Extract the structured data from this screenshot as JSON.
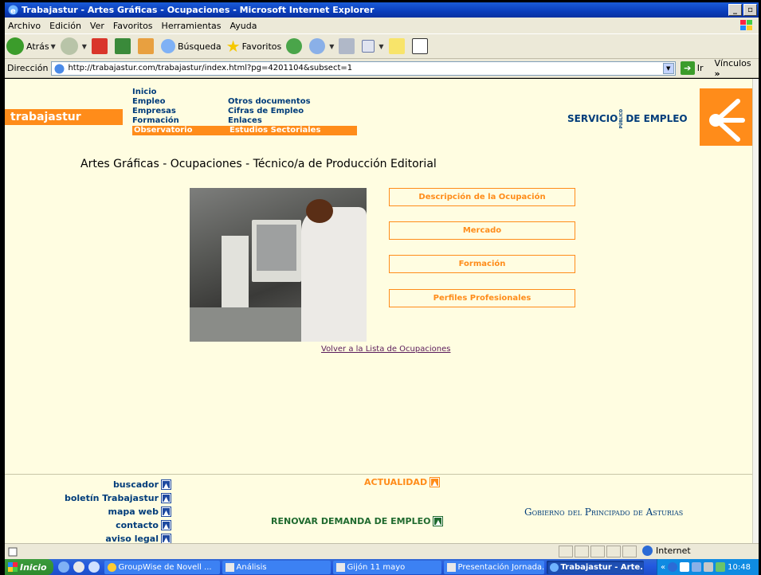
{
  "window": {
    "title": "Trabajastur - Artes Gráficas - Ocupaciones - Microsoft Internet Explorer"
  },
  "menu": [
    "Archivo",
    "Edición",
    "Ver",
    "Favoritos",
    "Herramientas",
    "Ayuda"
  ],
  "toolbar": {
    "back_label": "Atrás",
    "search_label": "Búsqueda",
    "favorites_label": "Favoritos"
  },
  "address": {
    "label": "Dirección",
    "url": "http://trabajastur.com/trabajastur/index.html?pg=4201104&subsect=1",
    "go_label": "Ir",
    "links_label": "Vínculos"
  },
  "site": {
    "logo": "trabajastur",
    "nav_col1": [
      "Inicio",
      "Empleo",
      "Empresas",
      "Formación",
      "Observatorio"
    ],
    "nav_col2": [
      "Otros documentos",
      "Cifras de Empleo",
      "Enlaces",
      "Estudios Sectoriales"
    ],
    "servicio_left": "SERVICIO",
    "servicio_pub": "PÚBLICO",
    "servicio_right": "DE EMPLEO"
  },
  "page": {
    "heading": "Artes Gráficas - Ocupaciones - Técnico/a de Producción Editorial",
    "options": [
      "Descripción de la Ocupación",
      "Mercado",
      "Formación",
      "Perfiles Profesionales"
    ],
    "back_link": "Volver a la Lista de Ocupaciones"
  },
  "footer": {
    "links": [
      "buscador",
      "boletín Trabajastur",
      "mapa web",
      "contacto",
      "aviso legal"
    ],
    "actualidad": "ACTUALIDAD",
    "renovar": "RENOVAR DEMANDA DE EMPLEO",
    "gobierno": "Gobierno del Principado de Asturias"
  },
  "status": {
    "zone": "Internet"
  },
  "taskbar": {
    "start": "Inicio",
    "tasks": [
      "GroupWise de Novell ...",
      "Análisis",
      "Gijón 11 mayo",
      "Presentación Jornada...",
      "Trabajastur - Arte..."
    ],
    "clock": "10:48"
  },
  "colors": {
    "accent_orange": "#ff8c1a",
    "nav_blue": "#003c7a",
    "page_bg": "#fffde1",
    "renovar_green": "#1f6a2e"
  }
}
